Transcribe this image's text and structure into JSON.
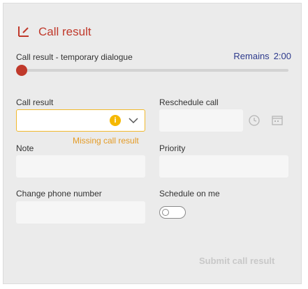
{
  "title": "Call result",
  "timer": {
    "label": "Call result - temporary dialogue",
    "remaining_label": "Remains",
    "remaining_value": "2:00",
    "progress": 0.0
  },
  "fields": {
    "call_result": {
      "label": "Call result",
      "value": "",
      "error": "Missing call result"
    },
    "reschedule": {
      "label": "Reschedule call",
      "value": ""
    },
    "note": {
      "label": "Note",
      "value": ""
    },
    "priority": {
      "label": "Priority",
      "value": ""
    },
    "change_phone": {
      "label": "Change phone number",
      "value": ""
    },
    "schedule_on_me": {
      "label": "Schedule on me",
      "checked": false
    }
  },
  "submit_label": "Submit call result",
  "colors": {
    "accent": "#c0392b",
    "remaining": "#2d3a8c",
    "warning": "#f5b800",
    "error_text": "#e49b25"
  },
  "icons": {
    "title": "call-result-icon",
    "warning": "info-warning-icon",
    "dropdown": "chevron-down-icon",
    "clock": "clock-icon",
    "calendar": "calendar-icon"
  }
}
